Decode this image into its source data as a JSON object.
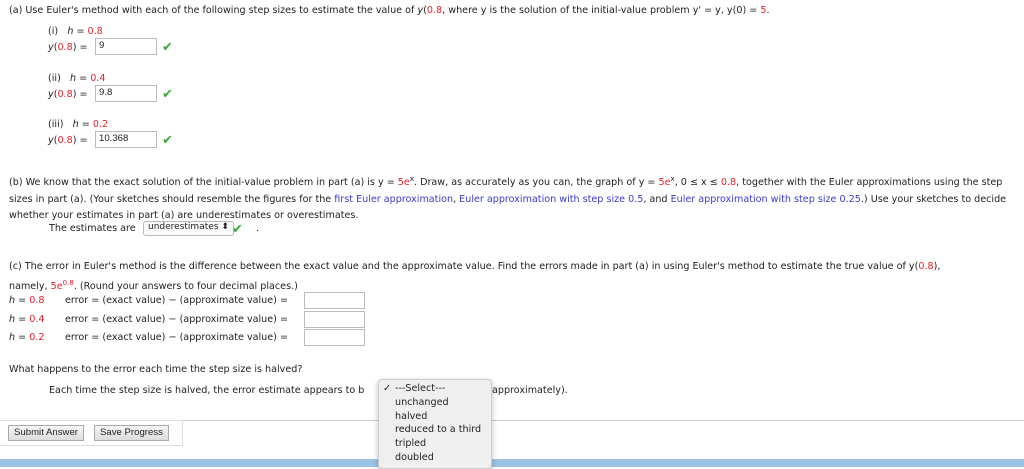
{
  "part_a": {
    "intro_before": "(a) Use Euler's method with each of the following step sizes to estimate the value of ",
    "y_label": "y",
    "arg": "0.8",
    "intro_after": ", where y is the solution of the initial-value problem y' = y, y(0) = ",
    "y0": "5",
    "items": [
      {
        "num": "(i)",
        "h": "0.8",
        "value": "9"
      },
      {
        "num": "(ii)",
        "h": "0.4",
        "value": "9.8"
      },
      {
        "num": "(iii)",
        "h": "0.2",
        "value": "10.368"
      }
    ],
    "h_label": "h = ",
    "y_of": "y(",
    "y_close": ") = "
  },
  "part_b": {
    "text1": "(b) We know that the exact solution of the initial-value problem in part (a) is y = ",
    "coef": "5e",
    "sup": "x",
    "text2": ". Draw, as accurately as you can, the graph of y = ",
    "text3": ", 0 ≤ x ≤ ",
    "upper": "0.8",
    "text4": ", together with the Euler approximations using the step sizes in part (a). (Your sketches should resemble the figures for the ",
    "link1": "first Euler approximation",
    "sep1": ", ",
    "link2": "Euler approximation with step size 0.5",
    "sep2": ", and ",
    "link3": "Euler approximation with step size 0.25",
    "text5": ".) Use your sketches to decide whether your estimates in part (a) are underestimates or overestimates.",
    "estimates_label": "The estimates are",
    "estimates_value": "underestimates",
    "period": "."
  },
  "part_c": {
    "text1": "(c) The error in Euler's method is the difference between the exact value and the approximate value. Find the errors made in part (a) in using Euler's method to estimate the true value of y(",
    "arg": "0.8",
    "text2": "),",
    "namely": "namely, ",
    "exact": "5e",
    "exact_sup": "0.8",
    "round": ". (Round your answers to four decimal places.)",
    "rows": [
      {
        "h": "0.8",
        "value": ""
      },
      {
        "h": "0.4",
        "value": ""
      },
      {
        "h": "0.2",
        "value": ""
      }
    ],
    "h_label": "h = ",
    "error_label": "error = (exact value) − (approximate value) ="
  },
  "part_d": {
    "question": "What happens to the error each time the step size is halved?",
    "sentence_before": "Each time the step size is halved, the error estimate appears to b",
    "sentence_after": "approximately).",
    "options": [
      "---Select---",
      "unchanged",
      "halved",
      "reduced to a third",
      "tripled",
      "doubled"
    ],
    "selected_mark": "✓"
  },
  "buttons": {
    "submit": "Submit Answer",
    "save": "Save Progress"
  },
  "colors": {
    "red": "#e8202a",
    "link": "#3a3ad0",
    "check": "#3aa83a",
    "bottom_bar": "#9cc3e4"
  }
}
